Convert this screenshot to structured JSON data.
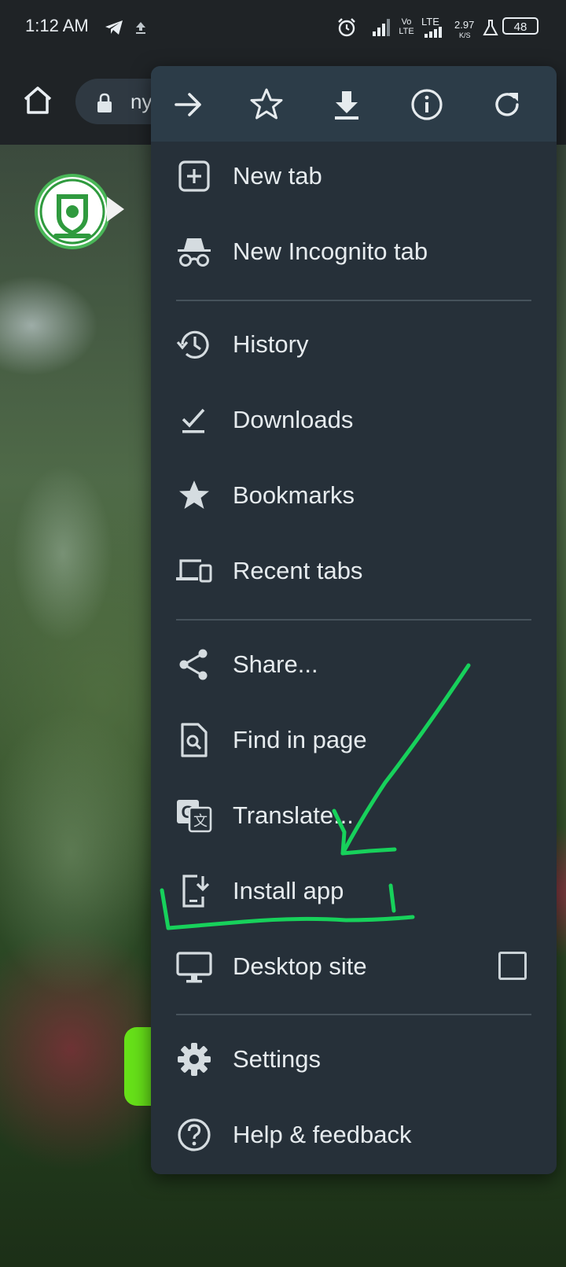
{
  "status_bar": {
    "time": "1:12 AM",
    "volte": "Vo LTE",
    "lte": "LTE",
    "net_speed": "2.97",
    "net_speed_unit": "K/S",
    "battery": "48"
  },
  "toolbar": {
    "url": "ny"
  },
  "menu": {
    "top_actions": [
      "forward-icon",
      "bookmark-star-icon",
      "download-icon",
      "info-icon",
      "reload-icon"
    ],
    "items": [
      {
        "label": "New tab",
        "icon": "new-tab-icon"
      },
      {
        "label": "New Incognito tab",
        "icon": "incognito-icon"
      },
      {
        "label": "History",
        "icon": "history-icon"
      },
      {
        "label": "Downloads",
        "icon": "downloads-icon"
      },
      {
        "label": "Bookmarks",
        "icon": "bookmarks-star-icon"
      },
      {
        "label": "Recent tabs",
        "icon": "devices-icon"
      },
      {
        "label": "Share...",
        "icon": "share-icon"
      },
      {
        "label": "Find in page",
        "icon": "find-in-page-icon"
      },
      {
        "label": "Translate...",
        "icon": "translate-icon"
      },
      {
        "label": "Install app",
        "icon": "install-app-icon"
      },
      {
        "label": "Desktop site",
        "icon": "desktop-icon",
        "checked": false
      },
      {
        "label": "Settings",
        "icon": "settings-gear-icon"
      },
      {
        "label": "Help & feedback",
        "icon": "help-icon"
      }
    ]
  },
  "colors": {
    "menu_bg": "#263039",
    "menu_top_bg": "#2c3c48",
    "annotation": "#17d15b",
    "cta_green": "#66e019"
  }
}
